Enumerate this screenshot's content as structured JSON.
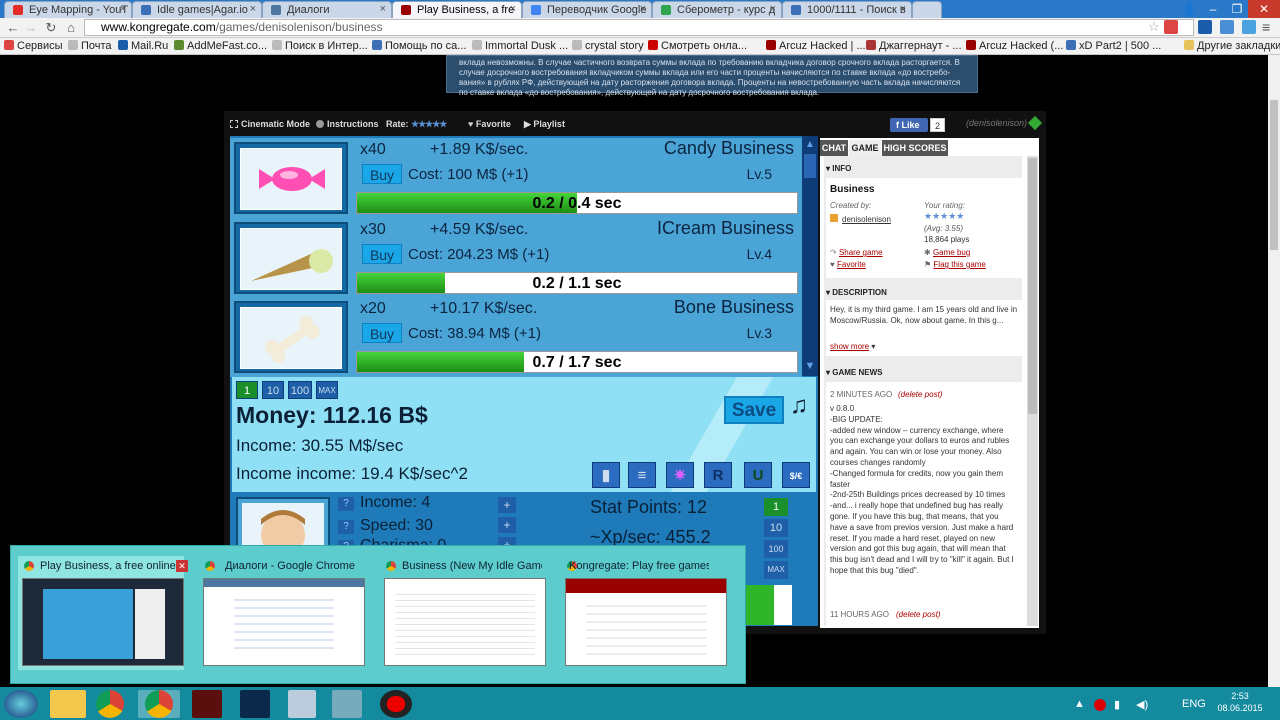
{
  "browser": {
    "tabs": [
      {
        "label": "Eye Mapping - YouT",
        "color": "#e52d27"
      },
      {
        "label": "Idle games|Agar.io",
        "color": "#3c6fb5"
      },
      {
        "label": "Диалоги",
        "color": "#4d76a1"
      },
      {
        "label": "Play Business, a fre",
        "color": "#990000"
      },
      {
        "label": "Переводчик Google",
        "color": "#4285f4"
      },
      {
        "label": "Сберометр - курс д",
        "color": "#2ea44f"
      },
      {
        "label": "1000/1111 - Поиск в",
        "color": "#3c6fb5"
      }
    ],
    "url_domain": "www.kongregate.com",
    "url_path": "/games/denisolenison/business",
    "bookmarks": [
      {
        "label": "Сервисы",
        "color": "#d44"
      },
      {
        "label": "Почта",
        "color": "#bbb"
      },
      {
        "label": "Mail.Ru",
        "color": "#1a5dab"
      },
      {
        "label": "AddMeFast.co...",
        "color": "#5c8a2f"
      },
      {
        "label": "Поиск в Интер...",
        "color": "#bbb"
      },
      {
        "label": "Помощь по са...",
        "color": "#3c6fb5"
      },
      {
        "label": "Immortal Dusk ...",
        "color": "#bbb"
      },
      {
        "label": "crystal story",
        "color": "#bbb"
      },
      {
        "label": "Смотреть онла...",
        "color": "#c00"
      },
      {
        "label": "Arcuz Hacked | ...",
        "color": "#900"
      },
      {
        "label": "Джаггернаут - ...",
        "color": "#a33"
      },
      {
        "label": "Arcuz Hacked (...",
        "color": "#900"
      },
      {
        "label": "xD Part2 | 500 ...",
        "color": "#3c6fb5"
      },
      {
        "label": "Другие закладки",
        "color": "#e8c25a"
      }
    ]
  },
  "notice": "вклада невозможны. В случае частичного возврата суммы вклада по требованию вкладчика договор срочного вклада расторгается. В случае досрочного востребования вкладчиком суммы вклада или его части проценты начисляются по ставке вклада «до востребо-вания» в рублях РФ, действующей на дату расторжения договора вклада. Проценты на невостребованную часть вклада начисляются по ставке вклада «до востребования», действующей на дату досрочного востребования вклада.",
  "gamebar": {
    "cinematic": "Cinematic Mode",
    "instructions": "Instructions",
    "rate": "Rate:",
    "stars": "★★★★★",
    "favorite": "Favorite",
    "playlist": "Playlist",
    "like": "Like",
    "like_count": "2",
    "username": "(denisolenison)"
  },
  "businesses": [
    {
      "count": "x40",
      "rate": "+1.89 K$/sec.",
      "name": "Candy Business",
      "buy": "Buy",
      "cost": "Cost: 100 M$ (+1)",
      "level": "Lv.5",
      "progress": "0.2 / 0.4 sec",
      "fraction": 0.5
    },
    {
      "count": "x30",
      "rate": "+4.59 K$/sec.",
      "name": "ICream Business",
      "buy": "Buy",
      "cost": "Cost: 204.23 M$ (+1)",
      "level": "Lv.4",
      "progress": "0.2 / 1.1 sec",
      "fraction": 0.2
    },
    {
      "count": "x20",
      "rate": "+10.17 K$/sec.",
      "name": "Bone Business",
      "buy": "Buy",
      "cost": "Cost: 38.94 M$ (+1)",
      "level": "Lv.3",
      "progress": "0.7 / 1.7 sec",
      "fraction": 0.38
    }
  ],
  "multipliers": [
    "1",
    "10",
    "100",
    "MAX"
  ],
  "money": {
    "money": "Money: 112.16 B$",
    "income": "Income: 30.55 M$/sec",
    "income_income": "Income income: 19.4 K$/sec^2",
    "save": "Save",
    "music": "♫"
  },
  "tools": [
    "▮",
    "≡",
    "✷",
    "R",
    "U",
    "$/€"
  ],
  "stats": {
    "income": "Income: 4",
    "speed": "Speed: 30",
    "charisma": "Charisma: 0",
    "stat_points": "Stat Points: 12",
    "xp": "~Xp/sec: 455.2",
    "q": "?",
    "plus": "+"
  },
  "stat_mults": [
    "1",
    "10",
    "100",
    "MAX"
  ],
  "side": {
    "tabs": [
      "CHAT",
      "GAME",
      "HIGH SCORES"
    ],
    "info_header": "INFO",
    "game_title": "Business",
    "created_by": "Created by:",
    "author": "denisolenison",
    "your_rating": "Your rating:",
    "rating_stars": "★★★★★",
    "avg": "(Avg: 3.55)",
    "plays": "18,864 plays",
    "share": "Share game",
    "bug": "Game bug",
    "favorite": "Favorite",
    "flag": "Flag this game",
    "desc_header": "DESCRIPTION",
    "desc": "Hey, it is my third game. I am 15 years old and live in Moscow/Russia. Ok, now about game. In this g...",
    "show_more": "show more",
    "news_header": "GAME NEWS",
    "news_time": "2 MINUTES AGO",
    "delete": "(delete post)",
    "news_body": "v 0.8.0\n-BIG UPDATE:\n-added new window – currency exchange, where you can exchange your dollars to euros and rubles and again. You can win or lose your money. Also courses changes randomly\n-Changed formula for credits, now you gain them faster\n-2nd-25th Buildings prices decreased by 10 times\n-and... i really hope that undefined bug has really gone. If you have this bug, that means, that you have a save from previos version. Just make a hard reset. If you made a hard reset, played on new version and got this bug again, that will mean that this bug isn't dead and I will try to \"kill\" it again. But I hope that this bug \"died\".",
    "news_time2": "11 HOURS AGO",
    "delete2": "(delete post)"
  },
  "switcher": [
    {
      "title": "Play Business, a free online g..."
    },
    {
      "title": "Диалоги - Google Chrome"
    },
    {
      "title": "Business (New My Idle Game) : i..."
    },
    {
      "title": "Kongregate: Play free games onl..."
    }
  ],
  "tray": {
    "lang": "ENG",
    "time": "2:53",
    "date": "08.06.2015"
  }
}
